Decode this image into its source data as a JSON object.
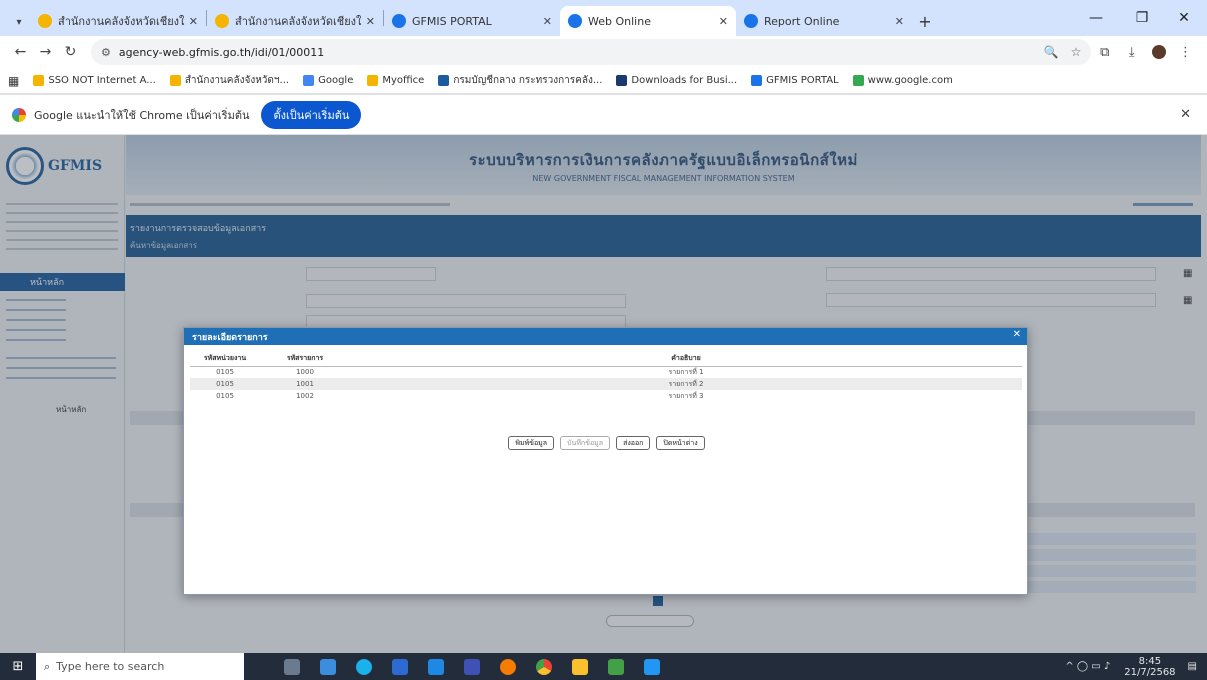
{
  "browser": {
    "tabs": [
      {
        "label": "สำนักงานคลังจังหวัดเชียงใหม่",
        "favicon_color": "#f4b400",
        "active": false
      },
      {
        "label": "สำนักงานคลังจังหวัดเชียงใหม่",
        "favicon_color": "#f4b400",
        "active": false
      },
      {
        "label": "GFMIS PORTAL",
        "favicon_color": "#1a73e8",
        "active": false
      },
      {
        "label": "Web Online",
        "favicon_color": "#1a73e8",
        "active": true
      },
      {
        "label": "Report Online",
        "favicon_color": "#1a73e8",
        "active": false
      }
    ],
    "url": "agency-web.gfmis.go.th/idi/01/00011",
    "bookmarks": [
      {
        "label": "SSO NOT Internet A...",
        "color": "#f4b400"
      },
      {
        "label": "สำนักงานคลังจังหวัดฯ...",
        "color": "#f4b400"
      },
      {
        "label": "Google",
        "color": "#4285f4"
      },
      {
        "label": "Myoffice",
        "color": "#f4b400"
      },
      {
        "label": "กรมบัญชีกลาง กระทรวงการคลัง...",
        "color": "#1c5b9e"
      },
      {
        "label": "Downloads for Busi...",
        "color": "#1a3a6e"
      },
      {
        "label": "GFMIS PORTAL",
        "color": "#1a73e8"
      },
      {
        "label": "www.google.com",
        "color": "#34a853"
      }
    ],
    "infobar_message": "Google แนะนำให้ใช้ Chrome เป็นค่าเริ่มต้น",
    "infobar_button": "ตั้งเป็นค่าเริ่มต้น"
  },
  "app": {
    "logo_text": "GFMIS",
    "banner_title": "ระบบบริหารการเงินการคลังภาครัฐแบบอิเล็กทรอนิกส์ใหม่",
    "banner_subtitle": "NEW GOVERNMENT FISCAL MANAGEMENT INFORMATION SYSTEM",
    "sidebar_menu_title": "หน้าหลัก",
    "page_title": "รายงานการตรวจสอบข้อมูลเอกสาร",
    "page_subtitle": "ค้นหาข้อมูลเอกสาร",
    "side_section_label": "หน้าหลัก"
  },
  "modal": {
    "title": "รายละเอียดรายการ",
    "columns": [
      "รหัสหน่วยงาน",
      "รหัสรายการ",
      "คำอธิบาย"
    ],
    "rows": [
      [
        "0105",
        "1000",
        "รายการที่ 1"
      ],
      [
        "0105",
        "1001",
        "รายการที่ 2"
      ],
      [
        "0105",
        "1002",
        "รายการที่ 3"
      ]
    ],
    "buttons": [
      "พิมพ์ข้อมูล",
      "บันทึกข้อมูล",
      "ส่งออก",
      "ปิดหน้าต่าง"
    ]
  },
  "taskbar": {
    "search_placeholder": "Type here to search",
    "time": "8:45",
    "date": "21/7/2568",
    "app_colors": [
      "#6b7b8f",
      "#3c8dde",
      "#1bb1ea",
      "#2d6bd3",
      "#1e88e5",
      "#3f51b5",
      "#e53935",
      "#f57c00",
      "#fbc02d",
      "#43a047",
      "#2196f3"
    ]
  }
}
